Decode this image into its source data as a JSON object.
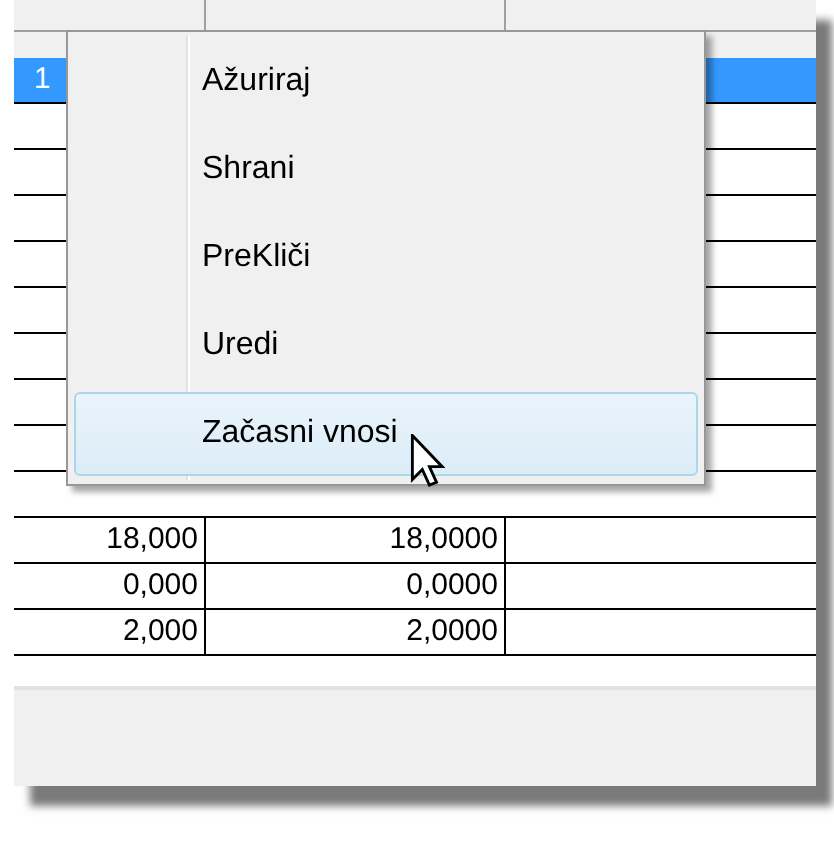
{
  "table": {
    "rows": [
      {
        "cells": [
          "1"
        ],
        "selected": true
      },
      {
        "cells": [
          "18,000",
          "18,0000"
        ],
        "selected": false
      },
      {
        "cells": [
          "0,000",
          "0,0000"
        ],
        "selected": false
      },
      {
        "cells": [
          "2,000",
          "2,0000"
        ],
        "selected": false
      }
    ]
  },
  "context_menu": {
    "items": [
      {
        "label": "Ažuriraj",
        "hovered": false
      },
      {
        "label": "Shrani",
        "hovered": false
      },
      {
        "label": "PreKliči",
        "hovered": false
      },
      {
        "label": "Uredi",
        "hovered": false
      },
      {
        "label": "Začasni vnosi",
        "hovered": true
      }
    ]
  }
}
